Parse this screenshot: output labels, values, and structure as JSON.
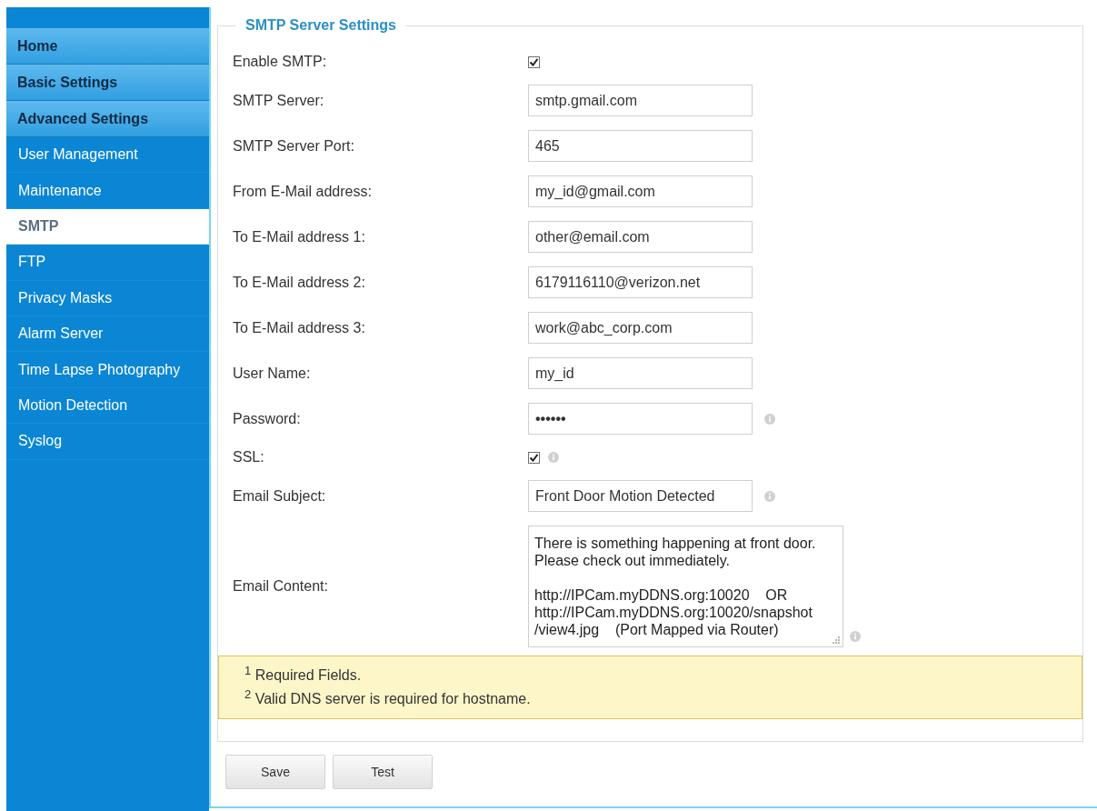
{
  "sidebar": {
    "items": [
      {
        "kind": "section",
        "label": "Home",
        "selected": false
      },
      {
        "kind": "section",
        "label": "Basic Settings",
        "selected": false
      },
      {
        "kind": "section",
        "label": "Advanced Settings",
        "selected": false
      },
      {
        "kind": "link",
        "label": "User Management",
        "selected": false
      },
      {
        "kind": "link",
        "label": "Maintenance",
        "selected": false
      },
      {
        "kind": "link",
        "label": "SMTP",
        "selected": true
      },
      {
        "kind": "link",
        "label": "FTP",
        "selected": false
      },
      {
        "kind": "link",
        "label": "Privacy Masks",
        "selected": false
      },
      {
        "kind": "link",
        "label": "Alarm Server",
        "selected": false
      },
      {
        "kind": "link",
        "label": "Time Lapse Photography",
        "selected": false
      },
      {
        "kind": "link",
        "label": "Motion Detection",
        "selected": false
      },
      {
        "kind": "link",
        "label": "Syslog",
        "selected": false
      }
    ]
  },
  "form": {
    "legend": "SMTP Server Settings",
    "fields": [
      {
        "kind": "checkbox",
        "label": "Enable SMTP:",
        "checked": true,
        "info": false
      },
      {
        "kind": "text",
        "label": "SMTP Server:",
        "value": "smtp.gmail.com",
        "info": false
      },
      {
        "kind": "text",
        "label": "SMTP Server Port:",
        "value": "465",
        "info": false
      },
      {
        "kind": "text",
        "label": "From E-Mail address:",
        "value": "my_id@gmail.com",
        "info": false
      },
      {
        "kind": "text",
        "label": "To E-Mail address 1:",
        "value": "other@email.com",
        "info": false
      },
      {
        "kind": "text",
        "label": "To E-Mail address 2:",
        "value": "6179116110@verizon.net",
        "info": false
      },
      {
        "kind": "text",
        "label": "To E-Mail address 3:",
        "value": "work@abc_corp.com",
        "info": false
      },
      {
        "kind": "text",
        "label": "User Name:",
        "value": "my_id",
        "info": false
      },
      {
        "kind": "password",
        "label": "Password:",
        "value": "••••••",
        "info": true
      },
      {
        "kind": "checkbox",
        "label": "SSL:",
        "checked": true,
        "info": true
      },
      {
        "kind": "text",
        "label": "Email Subject:",
        "value": "Front Door Motion Detected",
        "info": true
      },
      {
        "kind": "textarea",
        "label": "Email Content:",
        "value": "There is something happening at front door.\nPlease check out immediately.\n\nhttp://IPCam.myDDNS.org:10020    OR\nhttp://IPCam.myDDNS.org:10020/snapshot\n/view4.jpg    (Port Mapped via Router)",
        "info": true
      }
    ]
  },
  "notes": [
    "$^{1}$ Required Fields.",
    "$^{2}$ Valid DNS server is required for hostname."
  ],
  "buttons": [
    "Save",
    "Test"
  ]
}
